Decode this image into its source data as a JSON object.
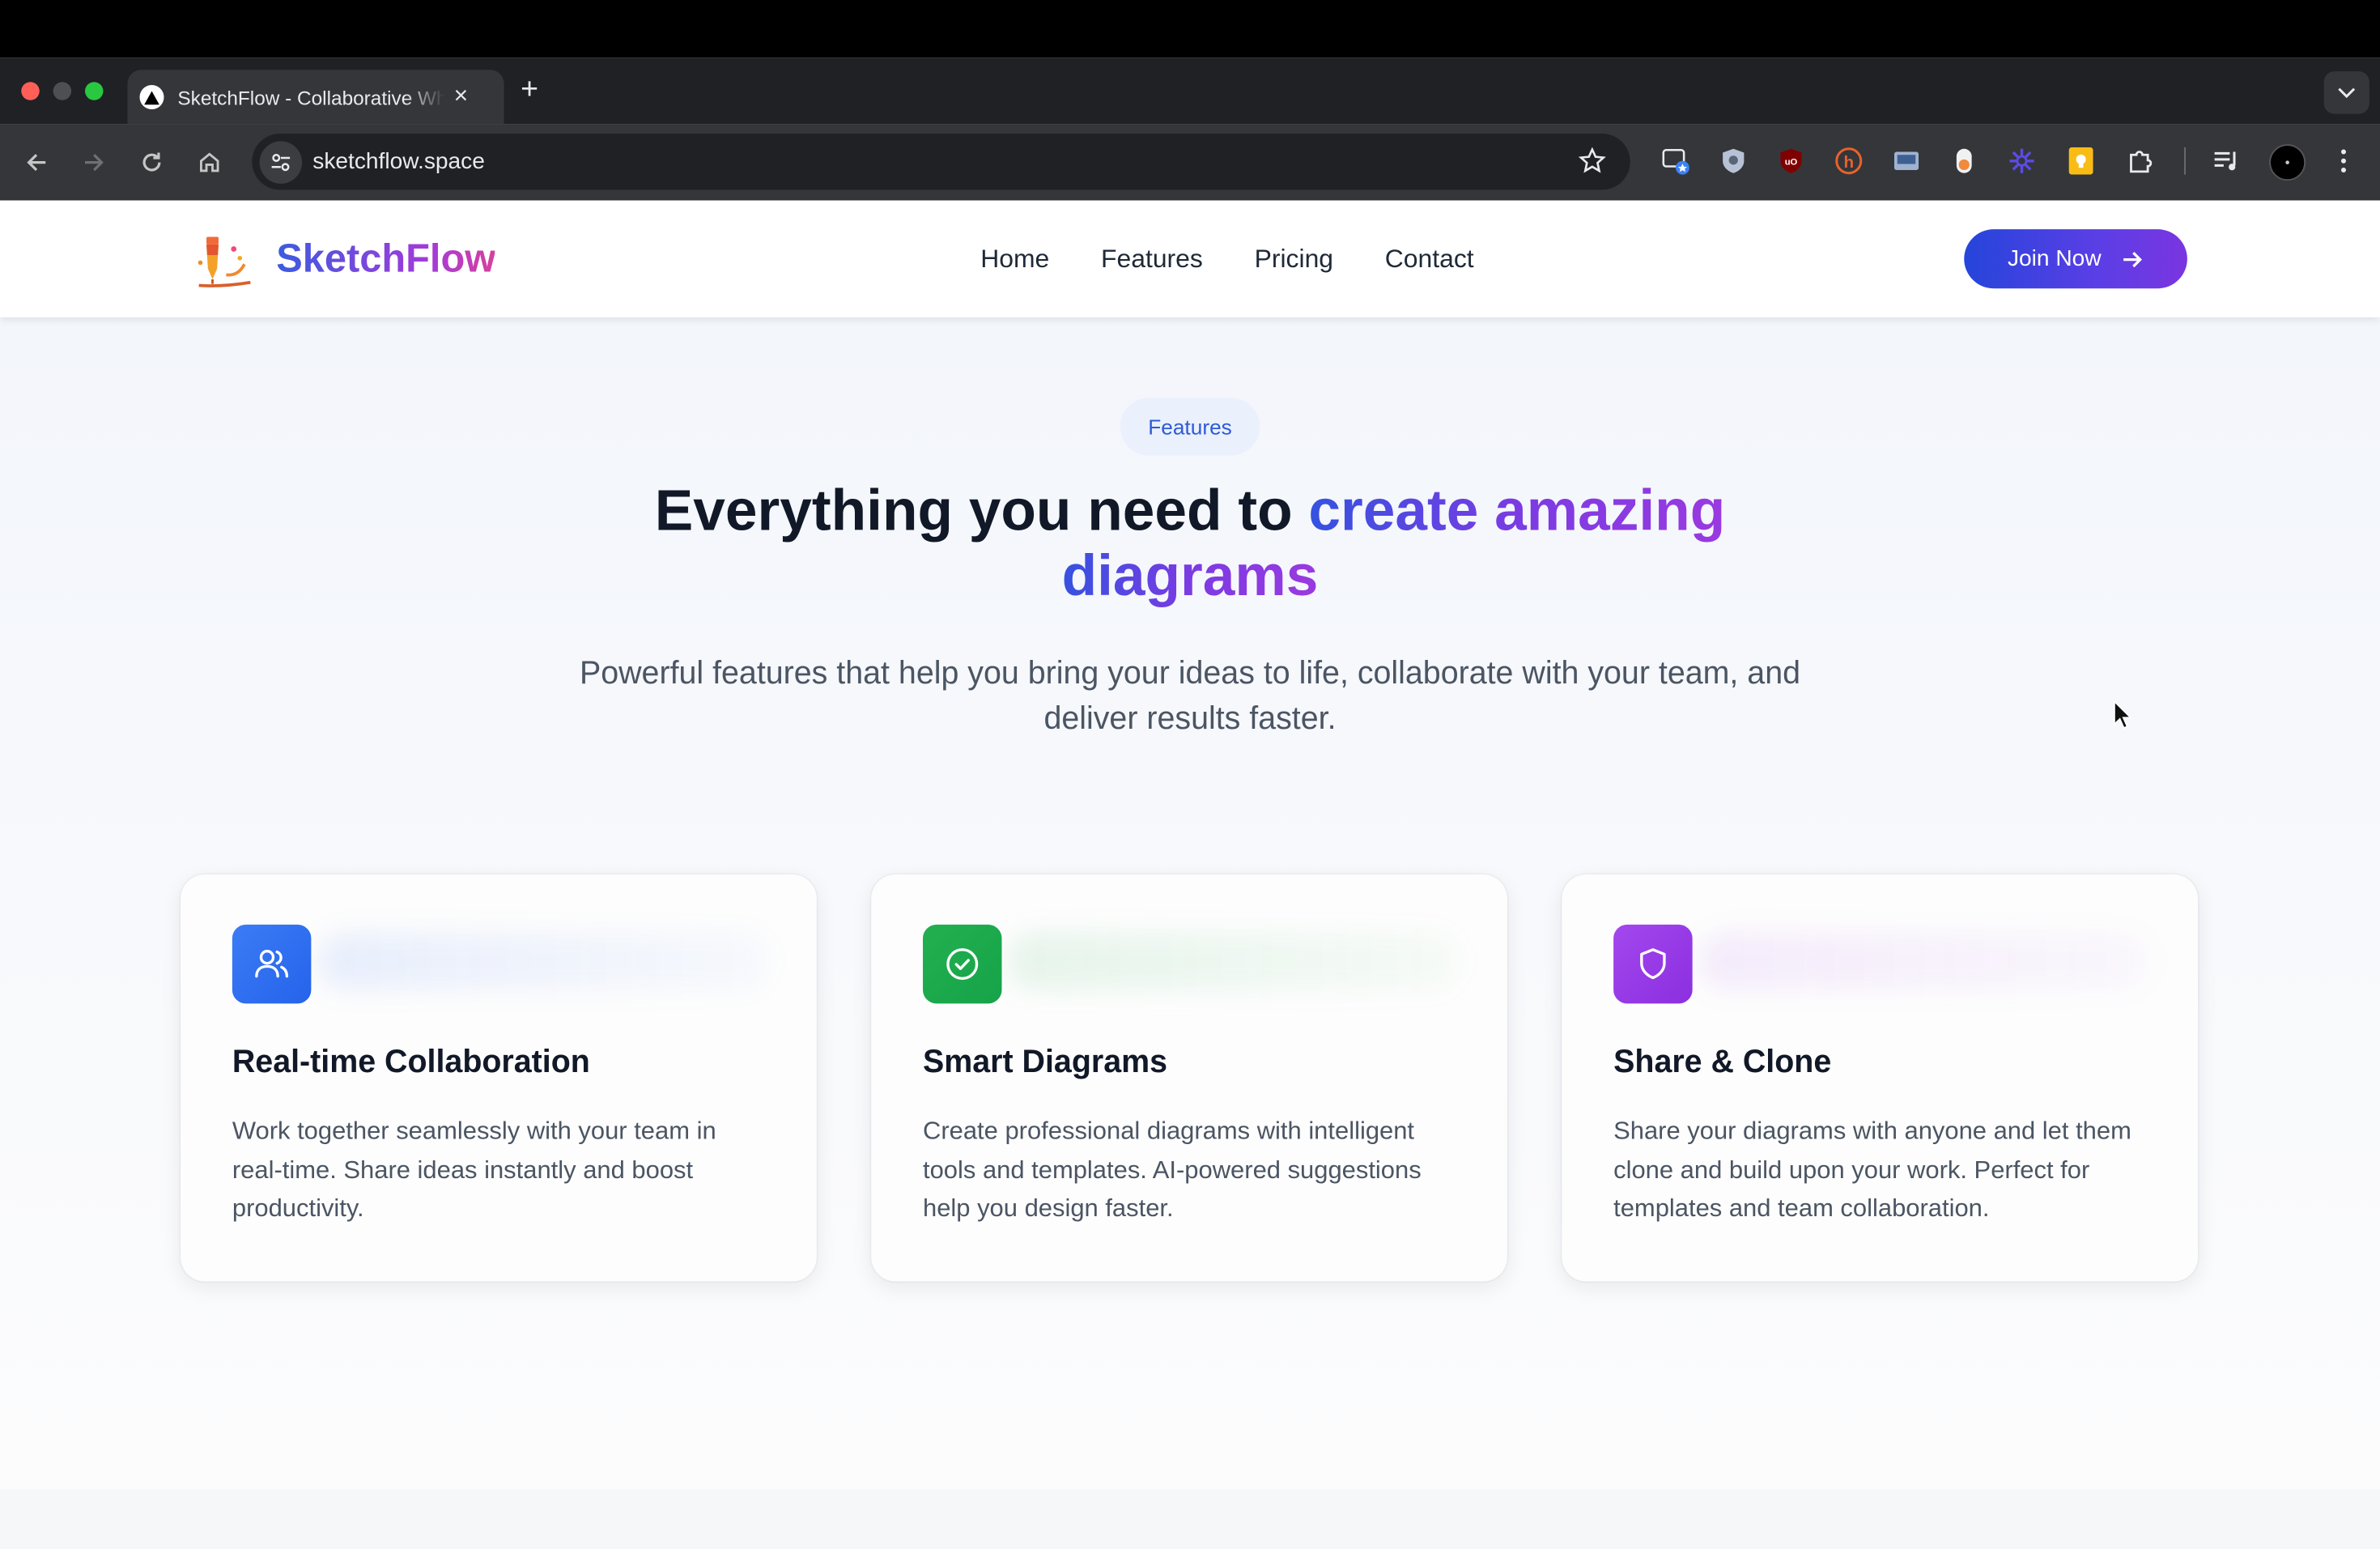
{
  "browser": {
    "tab_title": "SketchFlow - Collaborative Whiteboard",
    "url": "sketchflow.space",
    "extensions": [
      "tab-manager-icon",
      "shield-extension-icon",
      "ublock-icon",
      "honey-icon",
      "screenshot-extension-icon",
      "toggle-extension-icon",
      "perplexity-extension-icon",
      "keep-extension-icon",
      "extensions-puzzle-icon",
      "media-controls-icon",
      "profile-avatar",
      "more-menu-icon"
    ]
  },
  "site": {
    "brand": "SketchFlow",
    "nav": [
      "Home",
      "Features",
      "Pricing",
      "Contact"
    ],
    "cta": "Join Now"
  },
  "hero": {
    "badge": "Features",
    "headline_plain": "Everything you need to ",
    "headline_highlight_1": "create amazing",
    "headline_highlight_2": "diagrams",
    "subtitle_line1": "Powerful features that help you bring your ideas to life, collaborate with your team, and",
    "subtitle_line2": "deliver results faster."
  },
  "cards": [
    {
      "title": "Real-time Collaboration",
      "desc": "Work together seamlessly with your team in real-time. Share ideas instantly and boost productivity.",
      "icon": "users-icon",
      "color": "#2f6df0"
    },
    {
      "title": "Smart Diagrams",
      "desc": "Create professional diagrams with intelligent tools and templates. AI-powered suggestions help you design faster.",
      "icon": "check-circle-icon",
      "color": "#1fa848"
    },
    {
      "title": "Share & Clone",
      "desc": "Share your diagrams with anyone and let them clone and build upon your work. Perfect for templates and team collaboration.",
      "icon": "shield-icon",
      "color": "#9a3ce6"
    }
  ],
  "colors": {
    "accent_blue": "#3552e0",
    "accent_purple": "#9a3ae0",
    "chrome_dark": "#202124"
  }
}
